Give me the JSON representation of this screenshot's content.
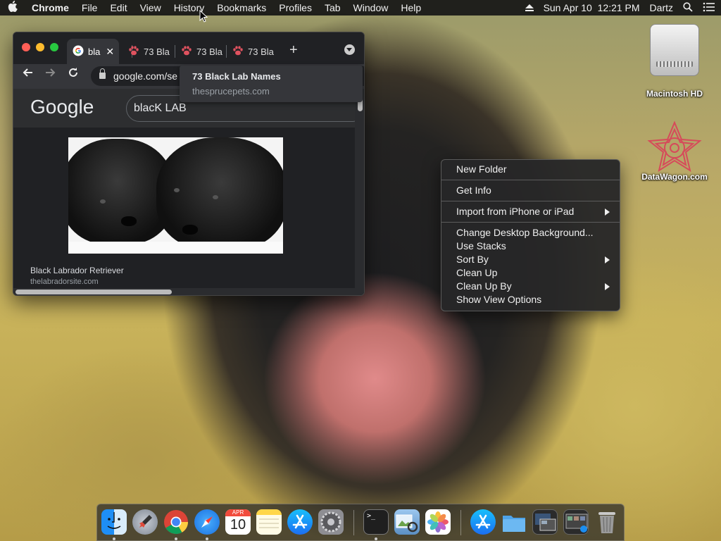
{
  "menubar": {
    "apple": "",
    "items": [
      "Chrome",
      "File",
      "Edit",
      "View",
      "History",
      "Bookmarks",
      "Profiles",
      "Tab",
      "Window",
      "Help"
    ],
    "clock": "Sun Apr 10  12:21 PM",
    "user": "Dartz"
  },
  "desktop": {
    "icons": [
      {
        "label": "Macintosh HD",
        "icon": "hard-drive-icon"
      },
      {
        "label": "DataWagon.com",
        "icon": "datawagon-logo-icon"
      }
    ]
  },
  "browser": {
    "tabs": [
      {
        "title": "bla",
        "favicon": "google-icon",
        "active": true
      },
      {
        "title": "73 Bla",
        "favicon": "paw-icon",
        "active": false
      },
      {
        "title": "73 Bla",
        "favicon": "paw-icon",
        "active": false
      },
      {
        "title": "73 Bla",
        "favicon": "paw-icon",
        "active": false
      }
    ],
    "new_tab": "+",
    "url": "google.com/se",
    "tooltip": {
      "title": "73 Black Lab Names",
      "domain": "thesprucepets.com"
    },
    "page": {
      "logo": "Google",
      "query": "blacK LAB",
      "image_title": "Black Labrador Retriever",
      "image_source": "thelabradorsite.com"
    }
  },
  "context_menu": {
    "groups": [
      [
        {
          "label": "New Folder"
        }
      ],
      [
        {
          "label": "Get Info"
        }
      ],
      [
        {
          "label": "Import from iPhone or iPad",
          "submenu": true
        }
      ],
      [
        {
          "label": "Change Desktop Background..."
        },
        {
          "label": "Use Stacks"
        },
        {
          "label": "Sort By",
          "submenu": true
        },
        {
          "label": "Clean Up"
        },
        {
          "label": "Clean Up By",
          "submenu": true
        },
        {
          "label": "Show View Options"
        }
      ]
    ]
  },
  "dock": {
    "calendar": {
      "month": "APR",
      "day": "10"
    },
    "apps": [
      "finder",
      "launchpad",
      "chrome",
      "safari",
      "calendar",
      "notes",
      "app-store",
      "system-preferences",
      "terminal",
      "preview",
      "photos",
      "app-store-downloads",
      "folder",
      "screenshots",
      "screenshots-2",
      "trash"
    ]
  },
  "colors": {
    "menu_bg": "#262628",
    "chrome_dark": "#202124",
    "chrome_tab": "#35363a",
    "light_close": "#ff5f57",
    "light_min": "#febc2e",
    "light_max": "#28c840"
  }
}
